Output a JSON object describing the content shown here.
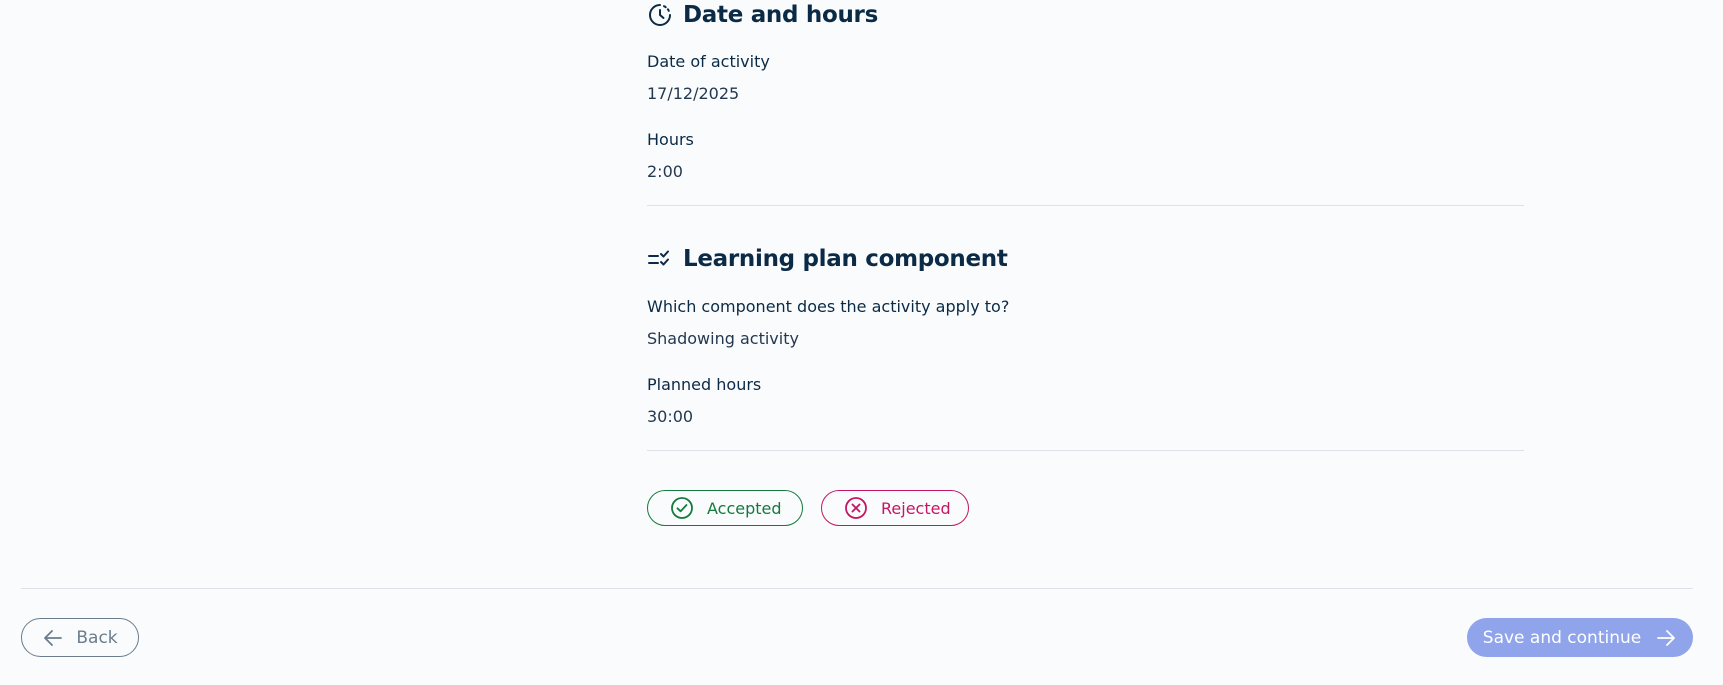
{
  "date_section": {
    "title": "Date and hours",
    "icon": "clock-icon",
    "fields": [
      {
        "label": "Date of activity",
        "value": "17/12/2025"
      },
      {
        "label": "Hours",
        "value": "2:00"
      }
    ]
  },
  "learning_section": {
    "title": "Learning plan component",
    "icon": "checklist-icon",
    "fields": [
      {
        "label": "Which component does the activity apply to?",
        "value": "Shadowing activity"
      },
      {
        "label": "Planned hours",
        "value": "30:00"
      }
    ]
  },
  "status": {
    "accepted_label": "Accepted",
    "rejected_label": "Rejected",
    "accepted_color": "#157a3d",
    "rejected_color": "#c41663"
  },
  "footer": {
    "back_label": "Back",
    "save_label": "Save and continue",
    "save_color": "#8fa4ea"
  }
}
